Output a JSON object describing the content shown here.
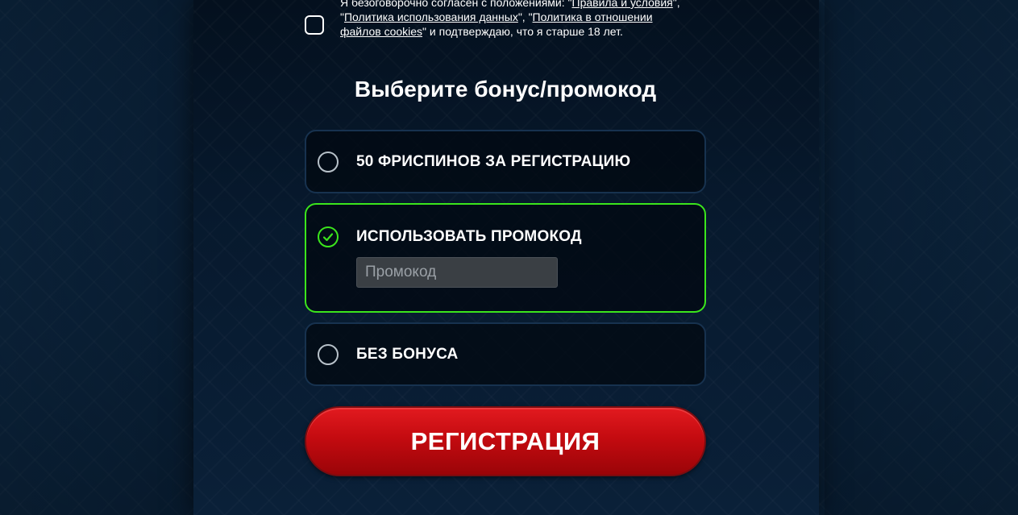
{
  "terms": {
    "prefix": "Я безоговорочно согласен с положениями: \"",
    "link_rules": "Правила и условия",
    "sep1": "\", \"",
    "link_data_policy": "Политика использования данных",
    "sep2": "\", \"",
    "link_cookies_policy": "Политика в отношении файлов cookies",
    "suffix": "\" и подтверждаю, что я старше 18 лет."
  },
  "bonus": {
    "title": "Выберите бонус/промокод",
    "options": [
      {
        "label": "50 ФРИСПИНОВ ЗА РЕГИСТРАЦИЮ",
        "selected": false
      },
      {
        "label": "ИСПОЛЬЗОВАТЬ ПРОМОКОД",
        "selected": true
      },
      {
        "label": "БЕЗ БОНУСА",
        "selected": false
      }
    ],
    "promo_placeholder": "Промокод",
    "promo_value": ""
  },
  "register": {
    "label": "РЕГИСТРАЦИЯ"
  },
  "colors": {
    "accent_green": "#3be51c",
    "button_red": "#c40b10",
    "background": "#0d2a47"
  },
  "icons": {
    "selected_option": "check-icon"
  }
}
